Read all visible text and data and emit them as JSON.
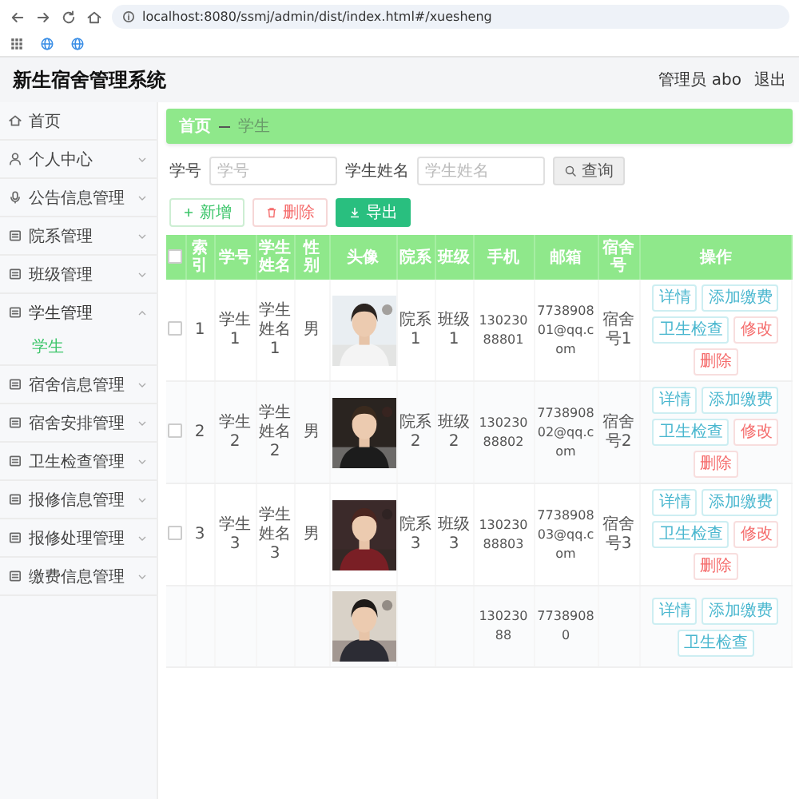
{
  "browser": {
    "url": "localhost:8080/ssmj/admin/dist/index.html#/xuesheng"
  },
  "app": {
    "title": "新生宿舍管理系统",
    "user": "管理员 abo",
    "logout": "退出"
  },
  "sidebar": {
    "items": [
      {
        "label": "首页"
      },
      {
        "label": "个人中心",
        "expanded": false
      },
      {
        "label": "公告信息管理",
        "expanded": false
      },
      {
        "label": "院系管理",
        "expanded": false
      },
      {
        "label": "班级管理",
        "expanded": false
      },
      {
        "label": "学生管理",
        "expanded": true,
        "children": [
          {
            "label": "学生",
            "selected": true
          }
        ]
      },
      {
        "label": "宿舍信息管理",
        "expanded": false
      },
      {
        "label": "宿舍安排管理",
        "expanded": false
      },
      {
        "label": "卫生检查管理",
        "expanded": false
      },
      {
        "label": "报修信息管理",
        "expanded": false
      },
      {
        "label": "报修处理管理",
        "expanded": false
      },
      {
        "label": "缴费信息管理",
        "expanded": false
      }
    ]
  },
  "breadcrumb": [
    "首页",
    "学生"
  ],
  "search": {
    "fields": [
      {
        "label": "学号",
        "placeholder": "学号"
      },
      {
        "label": "学生姓名",
        "placeholder": "学生姓名"
      }
    ],
    "button": "查询"
  },
  "toolbar": [
    {
      "label": "新增",
      "kind": "add"
    },
    {
      "label": "删除",
      "kind": "delete"
    },
    {
      "label": "导出",
      "kind": "export"
    }
  ],
  "table": {
    "header_checked": false,
    "columns": [
      "索引",
      "学号",
      "学生姓名",
      "性别",
      "头像",
      "院系",
      "班级",
      "手机",
      "邮箱",
      "宿舍号",
      "操作"
    ],
    "rows": [
      {
        "checked": false,
        "index": "1",
        "student_no": "学生1",
        "name": "学生姓名1",
        "gender": "男",
        "avatar": {
          "kind": "picture"
        },
        "department": "院系1",
        "class": "班级1",
        "phone": "13023088801",
        "email": "773890801@qq.com",
        "dorm": "宿舍号1",
        "actions": [
          {
            "label": "详情",
            "kind": "info"
          },
          {
            "label": "添加缴费",
            "kind": "info"
          },
          {
            "label": "卫生检查",
            "kind": "info"
          },
          {
            "label": "修改",
            "kind": "danger"
          },
          {
            "label": "删除",
            "kind": "danger"
          }
        ]
      },
      {
        "checked": false,
        "index": "2",
        "student_no": "学生2",
        "name": "学生姓名2",
        "gender": "男",
        "avatar": {
          "kind": "picture"
        },
        "department": "院系2",
        "class": "班级2",
        "phone": "13023088802",
        "email": "773890802@qq.com",
        "dorm": "宿舍号2",
        "actions": [
          {
            "label": "详情",
            "kind": "info"
          },
          {
            "label": "添加缴费",
            "kind": "info"
          },
          {
            "label": "卫生检查",
            "kind": "info"
          },
          {
            "label": "修改",
            "kind": "danger"
          },
          {
            "label": "删除",
            "kind": "danger"
          }
        ]
      },
      {
        "checked": false,
        "index": "3",
        "student_no": "学生3",
        "name": "学生姓名3",
        "gender": "男",
        "avatar": {
          "kind": "picture"
        },
        "department": "院系3",
        "class": "班级3",
        "phone": "13023088803",
        "email": "773890803@qq.com",
        "dorm": "宿舍号3",
        "actions": [
          {
            "label": "详情",
            "kind": "info"
          },
          {
            "label": "添加缴费",
            "kind": "info"
          },
          {
            "label": "卫生检查",
            "kind": "info"
          },
          {
            "label": "修改",
            "kind": "danger"
          },
          {
            "label": "删除",
            "kind": "danger"
          }
        ]
      },
      {
        "avatar": {
          "kind": "picture"
        },
        "phone": "13023088",
        "email": "77389080",
        "actions": [
          {
            "label": "详情",
            "kind": "info"
          },
          {
            "label": "添加缴费",
            "kind": "info"
          },
          {
            "label": "卫生检查",
            "kind": "info"
          }
        ]
      }
    ]
  }
}
